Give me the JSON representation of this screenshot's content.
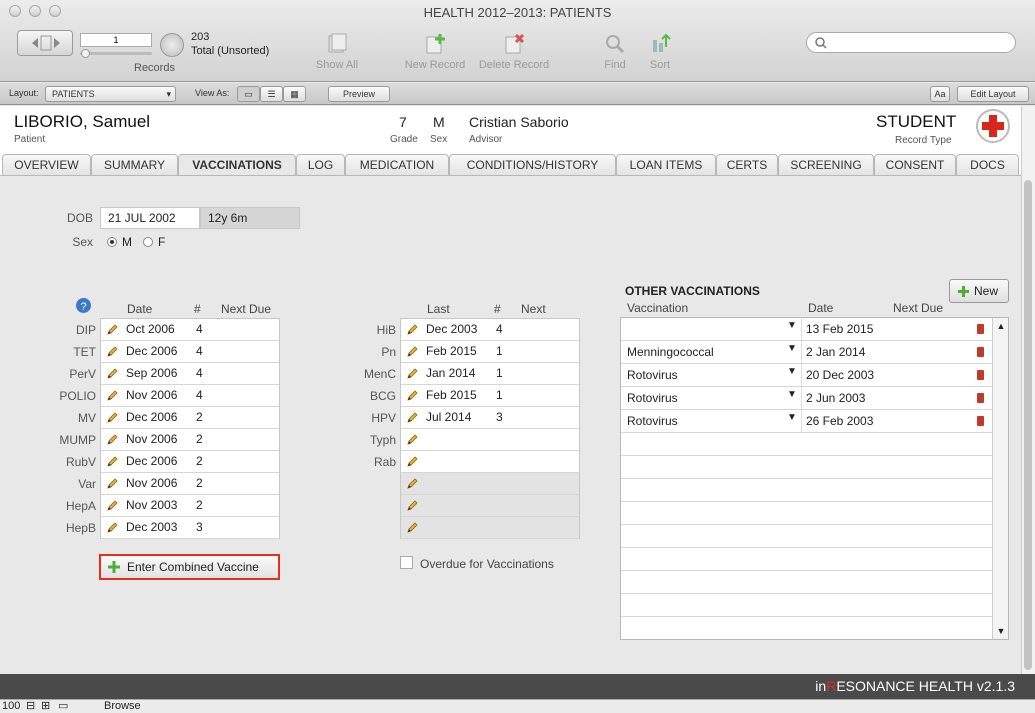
{
  "window": {
    "title": "HEALTH  2012–2013: PATIENTS"
  },
  "toolbar": {
    "record_number": "1",
    "records_label": "Records",
    "total_count": "203",
    "total_label": "Total (Unsorted)",
    "show_all": "Show All",
    "new_record": "New Record",
    "delete_record": "Delete Record",
    "find": "Find",
    "sort": "Sort"
  },
  "layout_bar": {
    "layout_label": "Layout:",
    "layout_value": "PATIENTS",
    "view_as_label": "View As:",
    "preview_label": "Preview",
    "aa_label": "Aa",
    "edit_layout_label": "Edit Layout"
  },
  "patient": {
    "name": "LIBORIO, Samuel",
    "name_caption": "Patient",
    "grade": "7",
    "grade_caption": "Grade",
    "sex": "M",
    "sex_caption": "Sex",
    "advisor": "Cristian Saborio",
    "advisor_caption": "Advisor",
    "record_type": "STUDENT",
    "record_type_caption": "Record Type"
  },
  "tabs": [
    "OVERVIEW",
    "SUMMARY",
    "VACCINATIONS",
    "LOG",
    "MEDICATION",
    "CONDITIONS/HISTORY",
    "LOAN ITEMS",
    "CERTS",
    "SCREENING",
    "CONSENT",
    "DOCS"
  ],
  "demographics": {
    "dob_label": "DOB",
    "dob_value": "21 JUL 2002",
    "age_value": "12y 6m",
    "sex_label": "Sex",
    "sex_m": "M",
    "sex_f": "F",
    "sex_selected": "M"
  },
  "left_table": {
    "headers": [
      "Date",
      "#",
      "Next Due"
    ],
    "rows": [
      {
        "label": "DIP",
        "date": "Oct 2006",
        "num": "4"
      },
      {
        "label": "TET",
        "date": "Dec 2006",
        "num": "4"
      },
      {
        "label": "PerV",
        "date": "Sep 2006",
        "num": "4"
      },
      {
        "label": "POLIO",
        "date": "Nov 2006",
        "num": "4"
      },
      {
        "label": "MV",
        "date": "Dec 2006",
        "num": "2"
      },
      {
        "label": "MUMP",
        "date": "Nov 2006",
        "num": "2"
      },
      {
        "label": "RubV",
        "date": "Dec 2006",
        "num": "2"
      },
      {
        "label": "Var",
        "date": "Nov 2006",
        "num": "2"
      },
      {
        "label": "HepA",
        "date": "Nov 2003",
        "num": "2"
      },
      {
        "label": "HepB",
        "date": "Dec 2003",
        "num": "3"
      }
    ]
  },
  "mid_table": {
    "headers": [
      "Last",
      "#",
      "Next"
    ],
    "rows": [
      {
        "label": "HiB",
        "date": "Dec 2003",
        "num": "4"
      },
      {
        "label": "Pn",
        "date": "Feb 2015",
        "num": "1"
      },
      {
        "label": "MenC",
        "date": "Jan 2014",
        "num": "1"
      },
      {
        "label": "BCG",
        "date": "Feb 2015",
        "num": "1"
      },
      {
        "label": "HPV",
        "date": "Jul 2014",
        "num": "3"
      },
      {
        "label": "Typh",
        "date": "",
        "num": ""
      },
      {
        "label": "Rab",
        "date": "",
        "num": ""
      },
      {
        "label": "",
        "date": "",
        "num": ""
      },
      {
        "label": "",
        "date": "",
        "num": ""
      },
      {
        "label": "",
        "date": "",
        "num": ""
      }
    ]
  },
  "combined_button": "Enter Combined Vaccine",
  "overdue_label": "Overdue for Vaccinations",
  "other": {
    "title": "OTHER VACCINATIONS",
    "new_label": "New",
    "headers": [
      "Vaccination",
      "Date",
      "Next Due"
    ],
    "rows": [
      {
        "name": "",
        "date": "13 Feb 2015"
      },
      {
        "name": "Menningococcal",
        "date": "2 Jan 2014"
      },
      {
        "name": "Rotovirus",
        "date": "20 Dec 2003"
      },
      {
        "name": "Rotovirus",
        "date": "2 Jun 2003"
      },
      {
        "name": "Rotovirus",
        "date": "26 Feb 2003"
      }
    ],
    "empty_rows": 9
  },
  "footer": {
    "brand_prefix": "in",
    "brand_r": "R",
    "brand_rest": "ESONANCE HEALTH v2.1.3"
  },
  "status": {
    "zoom": "100",
    "mode": "Browse"
  },
  "colors": {
    "highlight": "#e0301e",
    "plus": "#4caf34",
    "brand_r": "#e0301e"
  }
}
